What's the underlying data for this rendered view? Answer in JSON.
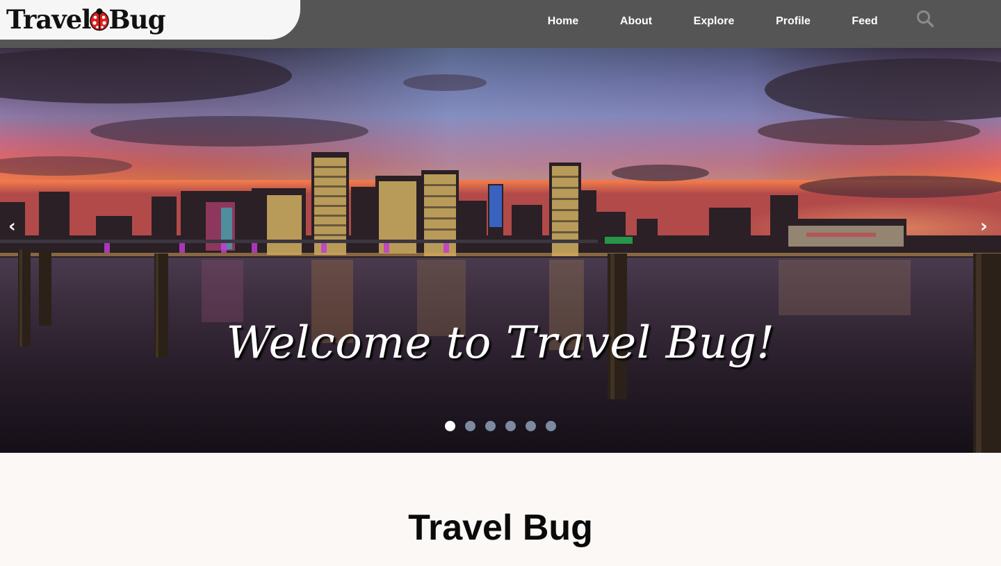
{
  "brand": {
    "logo_left": "Travel",
    "logo_right": "Bug"
  },
  "nav": {
    "items": [
      {
        "label": "Home"
      },
      {
        "label": "About"
      },
      {
        "label": "Explore"
      },
      {
        "label": "Profile"
      },
      {
        "label": "Feed"
      }
    ],
    "search_icon": "search-icon"
  },
  "hero": {
    "title": "Welcome to Travel Bug!",
    "prev_label": "‹",
    "next_label": "›",
    "slide_count": 6,
    "active_slide": 1
  },
  "section": {
    "title": "Travel Bug"
  },
  "colors": {
    "navbar": "#555555",
    "logo_tab": "#f6f6f6",
    "ladybug_red": "#e0201c",
    "dot_inactive": "#7d8aa0",
    "dot_active": "#ffffff",
    "section_bg": "#fbf8f6"
  }
}
